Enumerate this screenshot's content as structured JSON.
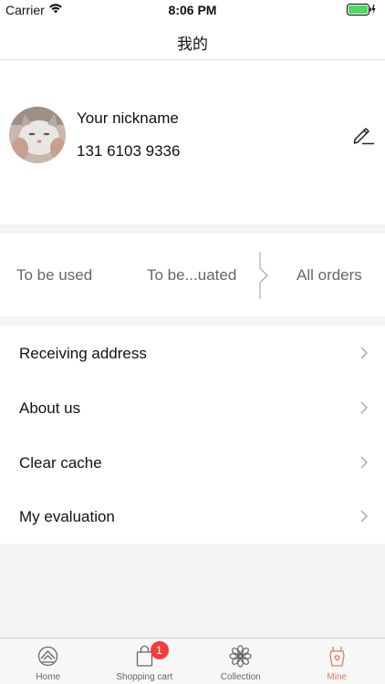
{
  "status_bar": {
    "carrier": "Carrier",
    "time": "8:06 PM"
  },
  "nav": {
    "title": "我的"
  },
  "profile": {
    "nickname": "Your nickname",
    "phone": "131 6103 9336"
  },
  "orders": {
    "tabs": [
      "To be used",
      "To be...uated",
      "All orders"
    ]
  },
  "menu": {
    "items": [
      {
        "label": "Receiving address"
      },
      {
        "label": "About us"
      },
      {
        "label": "Clear cache"
      },
      {
        "label": "My evaluation"
      }
    ]
  },
  "tab_bar": {
    "items": [
      {
        "label": "Home",
        "icon": "home-icon"
      },
      {
        "label": "Shopping cart",
        "icon": "shopping-bag-icon",
        "badge": "1"
      },
      {
        "label": "Collection",
        "icon": "flower-icon"
      },
      {
        "label": "Mine",
        "icon": "apron-icon"
      }
    ],
    "active_index": 3,
    "active_color": "#e8776a",
    "badge_color": "#f43d3d"
  }
}
